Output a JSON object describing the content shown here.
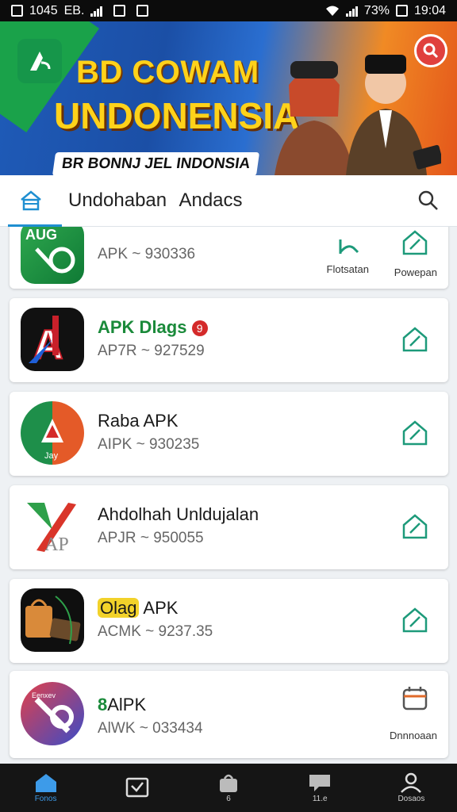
{
  "status_bar": {
    "left_text": "1045",
    "left_extra": "EB.",
    "time": "19:04",
    "battery_text": "73%"
  },
  "banner": {
    "title_line1": "BD COWAM",
    "title_line2": "UNDONENSIA",
    "subtitle": "BR BONNJ JEL INDONSIA",
    "colors": {
      "title": "#ffd21a",
      "background_start": "#1f5bb8",
      "background_end": "#e4561b"
    }
  },
  "header": {
    "title": "Undohaban Andacs",
    "home_icon": "home-tab-icon",
    "search_icon": "search-icon"
  },
  "apps": [
    {
      "name": "",
      "meta": "APK ~ 930336",
      "actions": [
        {
          "icon": "chart-icon",
          "label": "Flotsatan"
        },
        {
          "icon": "home-outline-icon",
          "label": "Powepan"
        }
      ]
    },
    {
      "name": "APK Dlags",
      "badge": "9",
      "meta": "AP7R ~ 927529",
      "actions": [
        {
          "icon": "home-outline-icon",
          "label": ""
        }
      ]
    },
    {
      "name": "Raba APK",
      "meta": "AIPK ~ 930235",
      "actions": [
        {
          "icon": "home-outline-icon",
          "label": ""
        }
      ]
    },
    {
      "name": "Ahdolhah Unldujalan",
      "meta": "APJR ~ 950055",
      "actions": [
        {
          "icon": "home-outline-icon",
          "label": ""
        }
      ]
    },
    {
      "name_highlight": "Olag",
      "name": "APK",
      "meta": "ACMK ~ 9237.35",
      "actions": [
        {
          "icon": "home-outline-icon",
          "label": ""
        }
      ]
    },
    {
      "name_highlight": "8",
      "name": "AlPK",
      "meta": "AlWK ~ 033434",
      "actions": [
        {
          "icon": "calendar-icon",
          "label": "Dnnnoaan"
        }
      ]
    }
  ],
  "app_icon_texts": {
    "first": "AUG",
    "second": "A",
    "third": "Jay",
    "fourth": "AP",
    "sixth": "Eenxev"
  },
  "bottom_nav": [
    {
      "label": "Fonos",
      "icon": "home-icon",
      "active": true
    },
    {
      "label": "",
      "icon": "inbox-icon",
      "active": false
    },
    {
      "label": "6",
      "icon": "bag-icon",
      "active": false
    },
    {
      "label": "11.e",
      "icon": "chat-icon",
      "active": false
    },
    {
      "label": "Dosaos",
      "icon": "profile-icon",
      "active": false
    }
  ],
  "colors": {
    "accent": "#1f8fd1",
    "action_green": "#1d9a7a",
    "nav_bg": "#151515"
  }
}
